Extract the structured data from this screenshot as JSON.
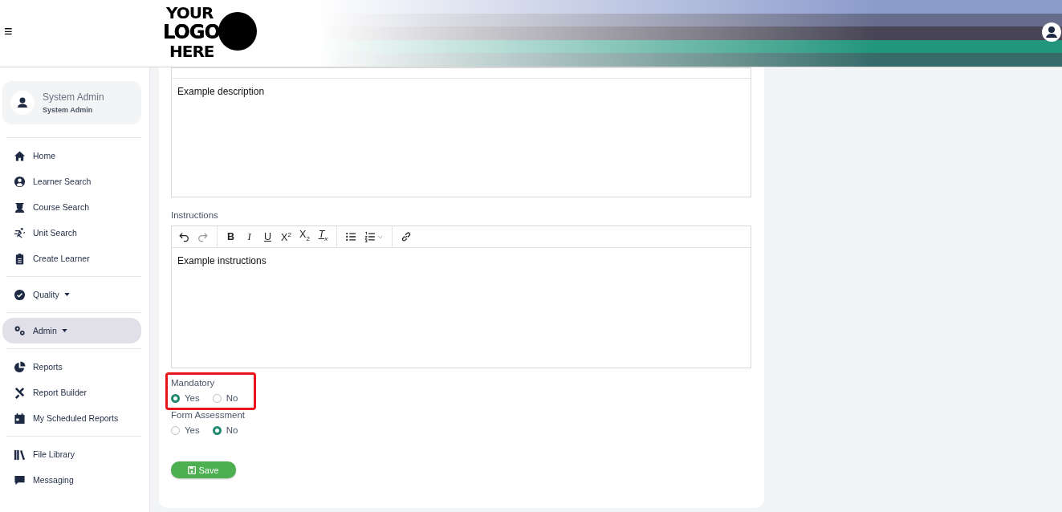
{
  "header": {
    "menu_glyph": "≡",
    "logo_lines": [
      "YOUR",
      "LOGO",
      "HERE"
    ]
  },
  "user": {
    "name": "System Admin",
    "role": "System Admin"
  },
  "nav_groups": [
    {
      "items": [
        {
          "label": "Home",
          "selected": false
        },
        {
          "label": "Learner Search",
          "selected": false
        },
        {
          "label": "Course Search",
          "selected": false
        },
        {
          "label": "Unit Search",
          "selected": false
        },
        {
          "label": "Create Learner",
          "selected": false
        }
      ]
    },
    {
      "items": [
        {
          "label": "Quality",
          "selected": false,
          "dropdown": true
        }
      ]
    },
    {
      "items": [
        {
          "label": "Admin",
          "selected": true,
          "dropdown": true
        }
      ]
    },
    {
      "items": [
        {
          "label": "Reports",
          "selected": false
        },
        {
          "label": "Report Builder",
          "selected": false
        },
        {
          "label": "My Scheduled Reports",
          "selected": false
        }
      ]
    },
    {
      "items": [
        {
          "label": "File Library",
          "selected": false
        },
        {
          "label": "Messaging",
          "selected": false
        }
      ]
    }
  ],
  "form": {
    "editors": [
      {
        "value": "Example description"
      },
      {
        "label": "Instructions",
        "value": "Example instructions",
        "toolbar": [
          {
            "kind": "undo"
          },
          {
            "kind": "redo",
            "disabled": true
          },
          {
            "kind": "sep"
          },
          {
            "kind": "bold",
            "text": "B"
          },
          {
            "kind": "italic",
            "text": "I"
          },
          {
            "kind": "underline",
            "text": "U"
          },
          {
            "kind": "superscript",
            "text": "X$^{2}$"
          },
          {
            "kind": "subscript",
            "text": "X$_{2}$"
          },
          {
            "kind": "clear",
            "text": "T$_{x}$"
          },
          {
            "kind": "sep"
          },
          {
            "kind": "bullets"
          },
          {
            "kind": "numbers"
          },
          {
            "kind": "sep"
          },
          {
            "kind": "link"
          }
        ]
      }
    ],
    "radio_groups": [
      {
        "label": "Mandatory",
        "highlighted": true,
        "options": [
          {
            "label": "Yes",
            "selected": true
          },
          {
            "label": "No",
            "selected": false
          }
        ]
      },
      {
        "label": "Form Assessment",
        "options": [
          {
            "label": "Yes",
            "selected": false
          },
          {
            "label": "No",
            "selected": true
          }
        ]
      }
    ],
    "save_button": "Save"
  }
}
